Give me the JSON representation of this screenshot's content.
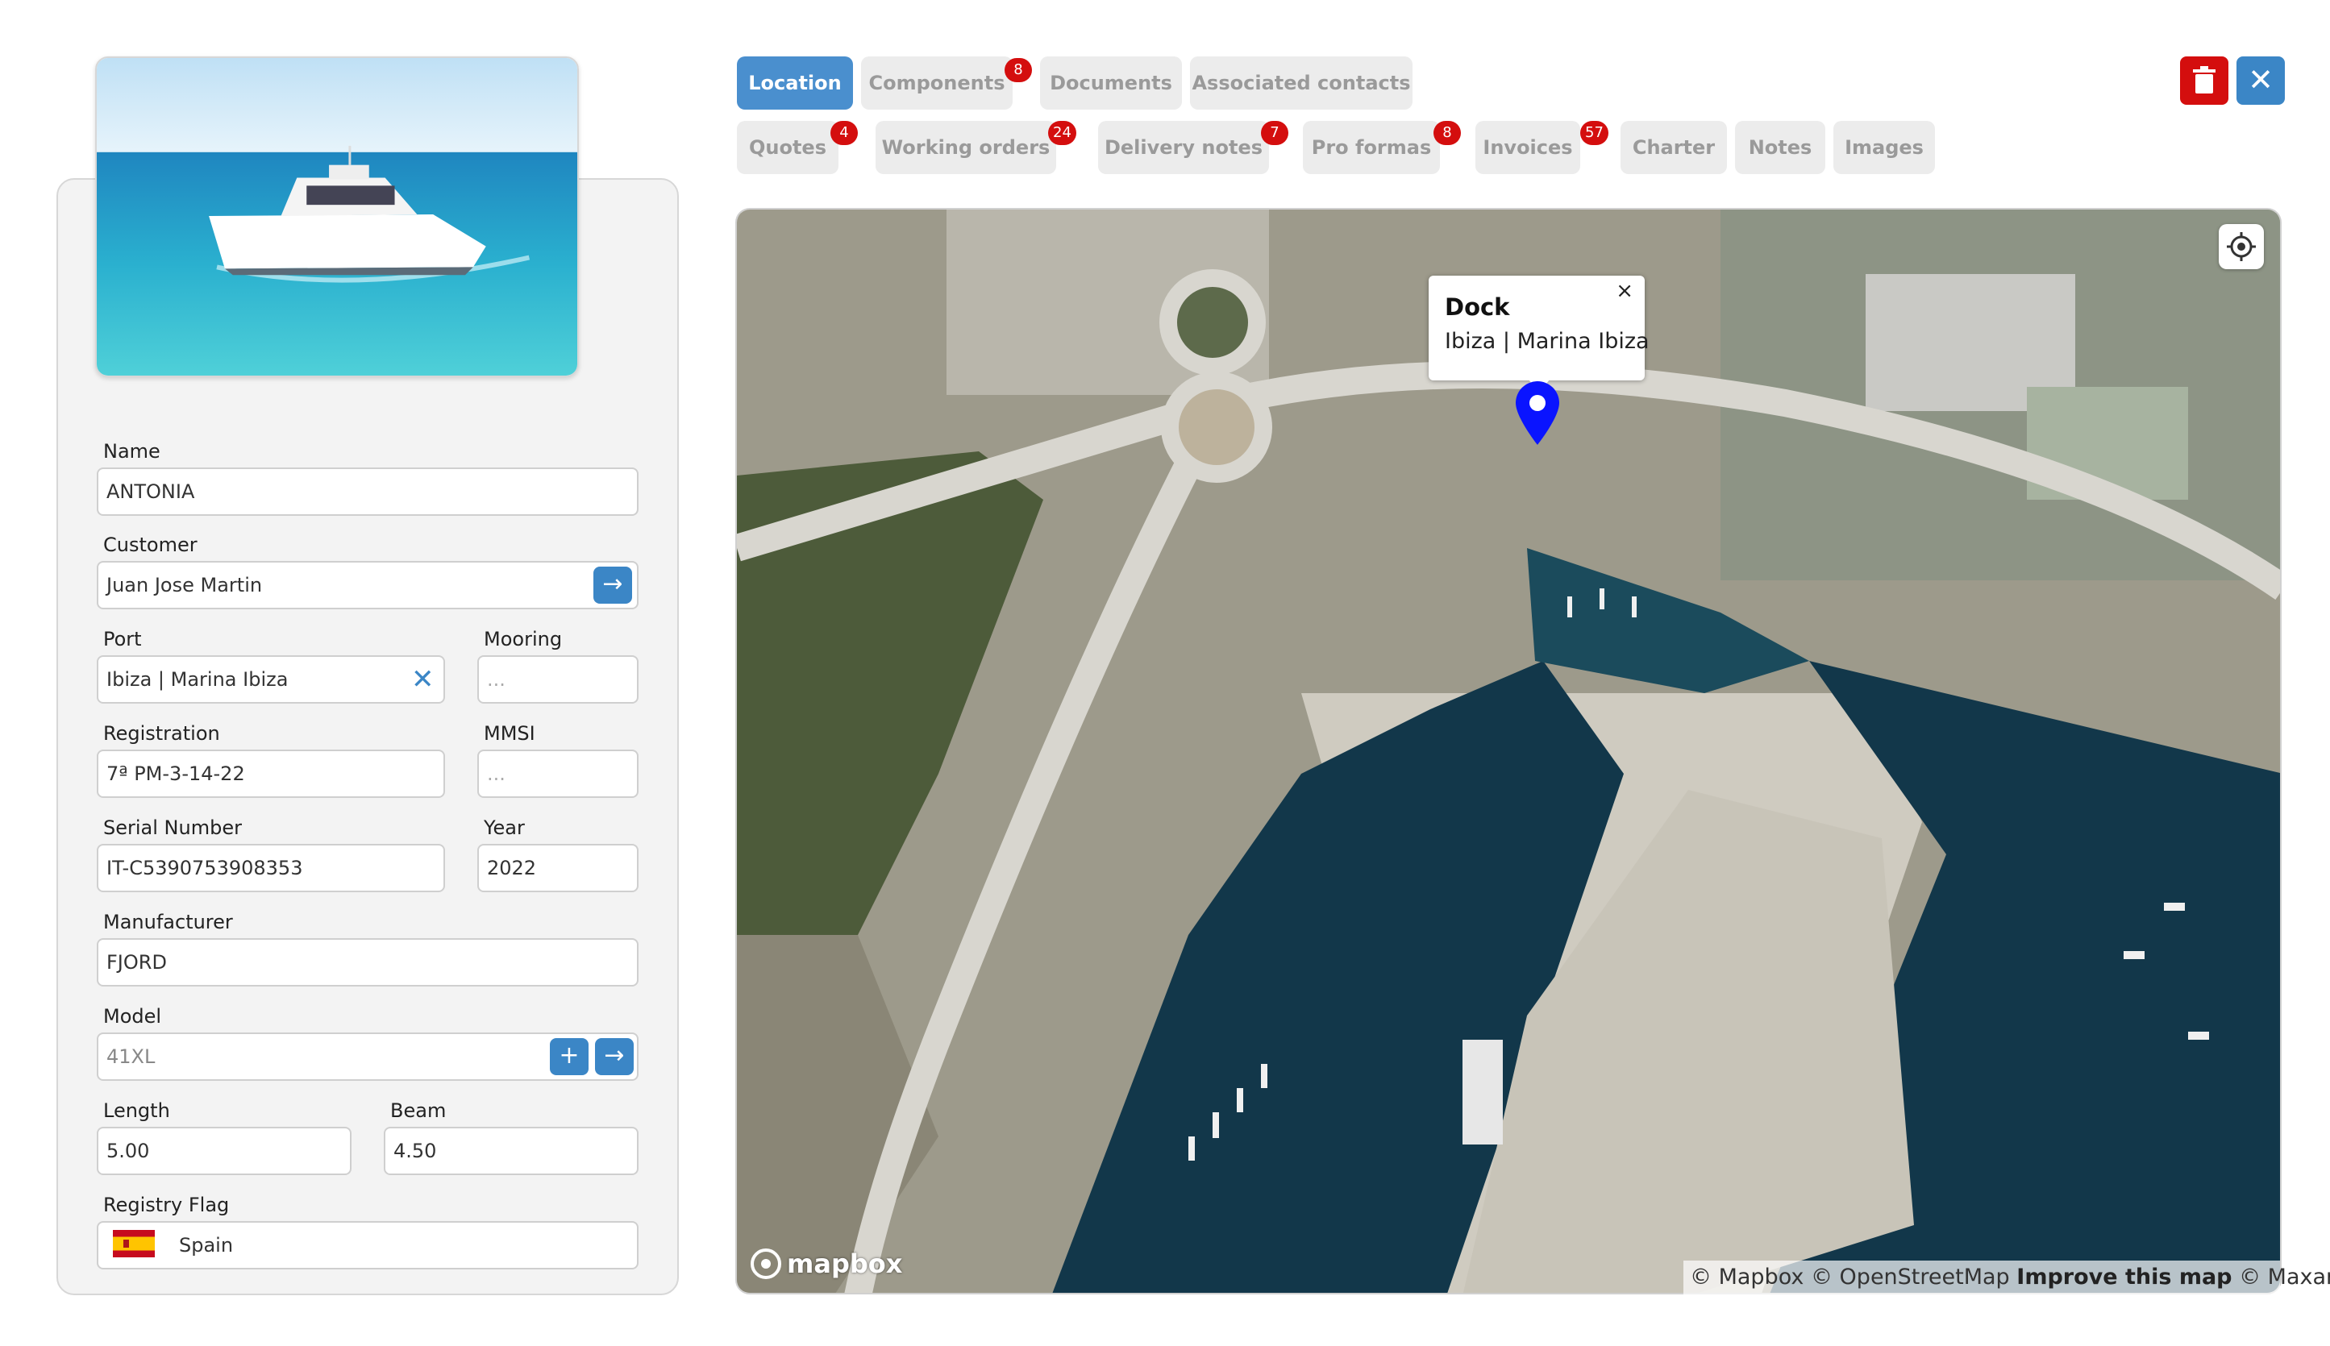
{
  "left_panel": {
    "name": {
      "label": "Name",
      "value": "ANTONIA"
    },
    "customer": {
      "label": "Customer",
      "value": "Juan Jose Martin"
    },
    "port": {
      "label": "Port",
      "value": "Ibiza | Marina Ibiza"
    },
    "mooring": {
      "label": "Mooring",
      "placeholder": "..."
    },
    "registration": {
      "label": "Registration",
      "value": "7ª PM-3-14-22"
    },
    "mmsi": {
      "label": "MMSI",
      "placeholder": "..."
    },
    "serial_number": {
      "label": "Serial Number",
      "value": "IT-C5390753908353"
    },
    "year": {
      "label": "Year",
      "value": "2022"
    },
    "manufacturer": {
      "label": "Manufacturer",
      "value": "FJORD"
    },
    "model": {
      "label": "Model",
      "value": "41XL"
    },
    "length": {
      "label": "Length",
      "value": "5.00"
    },
    "beam": {
      "label": "Beam",
      "value": "4.50"
    },
    "registry_flag": {
      "label": "Registry Flag",
      "value": "Spain",
      "flag_icon": "spain-flag-icon"
    }
  },
  "tabs": {
    "row1": [
      {
        "label": "Location",
        "active": true
      },
      {
        "label": "Components",
        "badge": "8"
      },
      {
        "label": "Documents"
      },
      {
        "label": "Associated contacts"
      }
    ],
    "row2": [
      {
        "label": "Quotes",
        "badge": "4"
      },
      {
        "label": "Working orders",
        "badge": "24"
      },
      {
        "label": "Delivery notes",
        "badge": "7"
      },
      {
        "label": "Pro formas",
        "badge": "8"
      },
      {
        "label": "Invoices",
        "badge": "57"
      },
      {
        "label": "Charter"
      },
      {
        "label": "Notes"
      },
      {
        "label": "Images"
      }
    ]
  },
  "actions": {
    "delete_icon": "trash-icon",
    "close_icon": "close-icon"
  },
  "map": {
    "popup_title": "Dock",
    "popup_subtitle": "Ibiza | Marina Ibiza",
    "popup_close": "×",
    "logo_text": "mapbox",
    "attribution": {
      "mapbox": "© Mapbox",
      "osm": "© OpenStreetMap",
      "improve": "Improve this map",
      "maxar": "© Maxar"
    }
  },
  "colors": {
    "primary": "#4a8fce",
    "danger": "#d40e0e",
    "pin": "#0a14ff",
    "sea": "#12374a"
  }
}
